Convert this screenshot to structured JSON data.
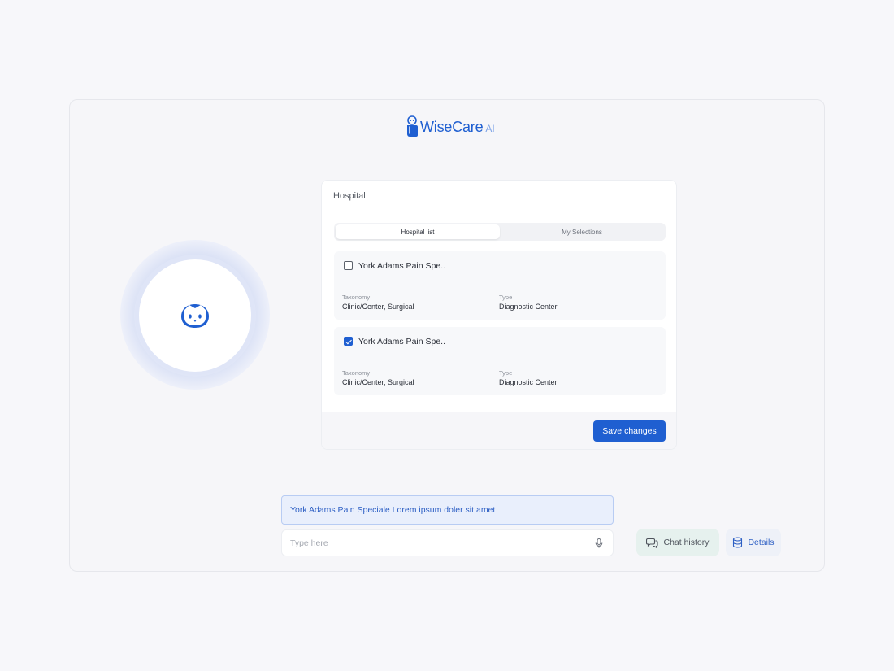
{
  "brand": {
    "name": "WiseCare",
    "suffix": "AI",
    "accent": "#1f5fd1"
  },
  "card": {
    "title": "Hospital",
    "tabs": [
      {
        "label": "Hospital list",
        "active": true
      },
      {
        "label": "My Selections",
        "active": false
      }
    ],
    "items": [
      {
        "name": "York Adams Pain Spe..",
        "checked": false,
        "taxonomy_label": "Taxonomy",
        "taxonomy_value": "Clinic/Center, Surgical",
        "type_label": "Type",
        "type_value": "Diagnostic Center"
      },
      {
        "name": "York Adams Pain Spe..",
        "checked": true,
        "taxonomy_label": "Taxonomy",
        "taxonomy_value": "Clinic/Center, Surgical",
        "type_label": "Type",
        "type_value": "Diagnostic Center"
      }
    ],
    "save_label": "Save changes"
  },
  "chat": {
    "suggestion": "York Adams Pain Speciale Lorem ipsum doler sit amet",
    "input_placeholder": "Type here",
    "input_value": "",
    "chat_history_label": "Chat history",
    "details_label": "Details"
  },
  "icons": {
    "logo": "owl-logo-icon",
    "avatar": "owl-face-icon",
    "mic": "microphone-icon",
    "chat": "chat-bubbles-icon",
    "details": "database-icon"
  }
}
